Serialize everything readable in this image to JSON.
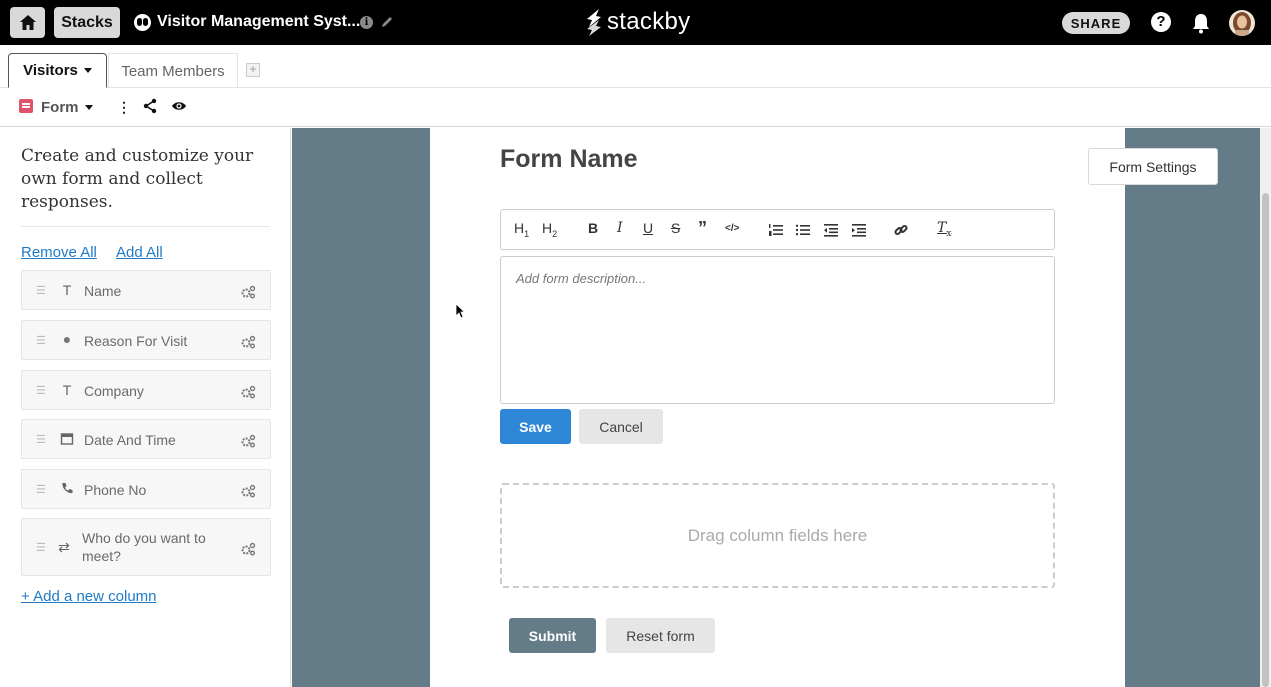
{
  "topbar": {
    "home_icon": "home-icon",
    "stacks_label": "Stacks",
    "stack_name": "Visitor Management Syst...",
    "logo_text": "stackby",
    "share_label": "SHARE",
    "help_label": "?"
  },
  "tabs": [
    {
      "label": "Visitors",
      "active": true
    },
    {
      "label": "Team Members",
      "active": false
    }
  ],
  "add_tab_label": "+",
  "view": {
    "name": "Form",
    "more_label": "⋮"
  },
  "left_panel": {
    "intro": "Create and customize your own form and collect responses.",
    "remove_all": "Remove All",
    "add_all": "Add All",
    "fields": [
      {
        "label": "Name",
        "type_icon": "T"
      },
      {
        "label": "Reason For Visit",
        "type_icon": "●"
      },
      {
        "label": "Company",
        "type_icon": "T"
      },
      {
        "label": "Date And Time",
        "type_icon": "calendar-icon"
      },
      {
        "label": "Phone No",
        "type_icon": "phone-icon"
      },
      {
        "label": "Who do you want to meet?",
        "type_icon": "⇄"
      }
    ],
    "add_column": "+ Add a new column"
  },
  "form": {
    "title": "Form Name",
    "settings_label": "Form Settings",
    "toolbar": [
      "H1",
      "H2",
      "B",
      "I",
      "U",
      "S",
      "”",
      "</>",
      "ordered-list",
      "bullet-list",
      "outdent",
      "indent",
      "link",
      "clear-format"
    ],
    "description_placeholder": "Add form description...",
    "save_label": "Save",
    "cancel_label": "Cancel",
    "dropzone_text": "Drag column fields here",
    "submit_label": "Submit",
    "reset_label": "Reset form"
  },
  "colors": {
    "topbar": "#000000",
    "canvas": "#647c87",
    "save": "#2e86d6",
    "link": "#1e7ac7",
    "form_icon": "#e0546a"
  }
}
